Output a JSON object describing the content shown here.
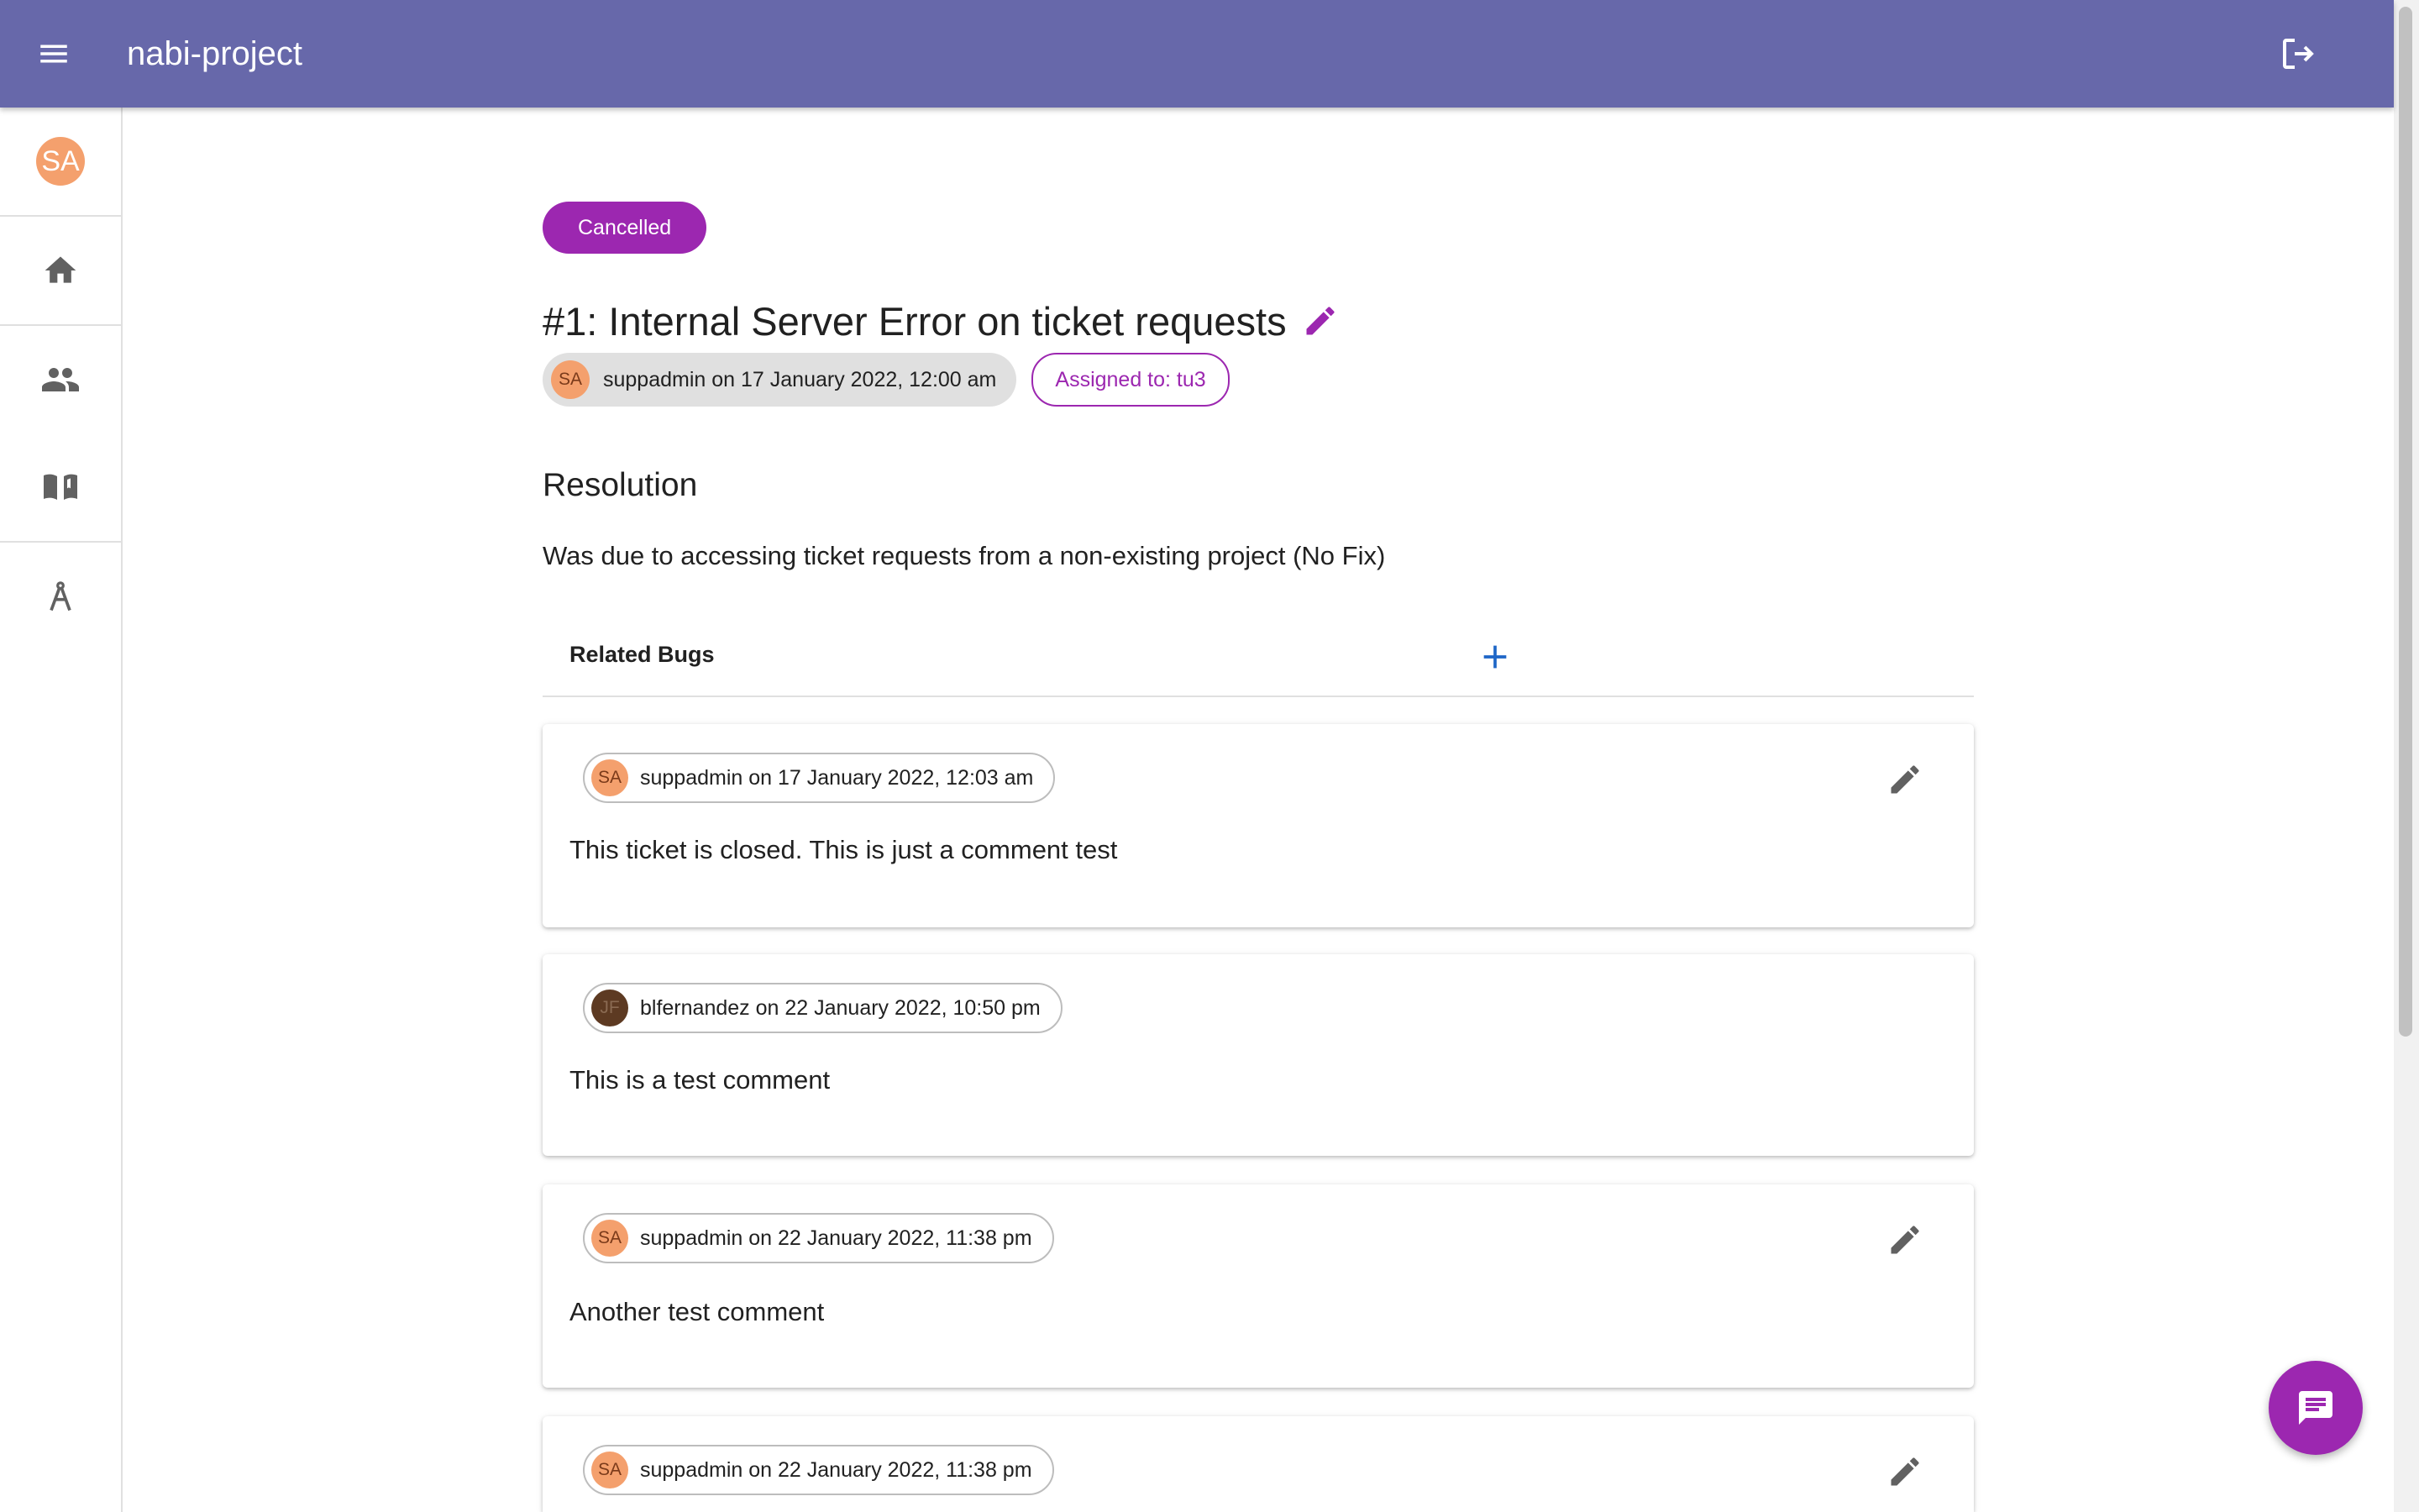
{
  "app": {
    "title": "nabi-project"
  },
  "icons": {
    "menu": "menu-icon",
    "logout": "logout-icon",
    "home": "home-icon",
    "people": "people-icon",
    "book": "book-icon",
    "compass": "compass-icon",
    "edit": "pencil-icon",
    "add": "plus-icon",
    "chat": "chat-icon"
  },
  "colors": {
    "appbar": "#6768aa",
    "accent": "#9c27b0",
    "avatar": "#f4a06d",
    "add_icon": "#1e66c7"
  },
  "sidebar": {
    "avatar_initials": "SA"
  },
  "ticket": {
    "status": "Cancelled",
    "title": "#1: Internal Server Error on ticket requests",
    "author_initials": "SA",
    "author_meta": "suppadmin on 17 January 2022, 12:00 am",
    "assigned": "Assigned to: tu3"
  },
  "resolution": {
    "heading": "Resolution",
    "text": "Was due to accessing ticket requests from a non-existing project (No Fix)"
  },
  "related_bugs": {
    "label": "Related Bugs"
  },
  "comments": [
    {
      "initials": "SA",
      "meta": "suppadmin on 17 January 2022, 12:03 am",
      "text": "This ticket is closed. This is just a comment test",
      "editable": true
    },
    {
      "initials": "JF",
      "meta": "blfernandez on 22 January 2022, 10:50 pm",
      "text": "This is a test comment",
      "editable": false
    },
    {
      "initials": "SA",
      "meta": "suppadmin on 22 January 2022, 11:38 pm",
      "text": "Another test comment",
      "editable": true
    },
    {
      "initials": "SA",
      "meta": "suppadmin on 22 January 2022, 11:38 pm",
      "text": "",
      "editable": true
    }
  ]
}
